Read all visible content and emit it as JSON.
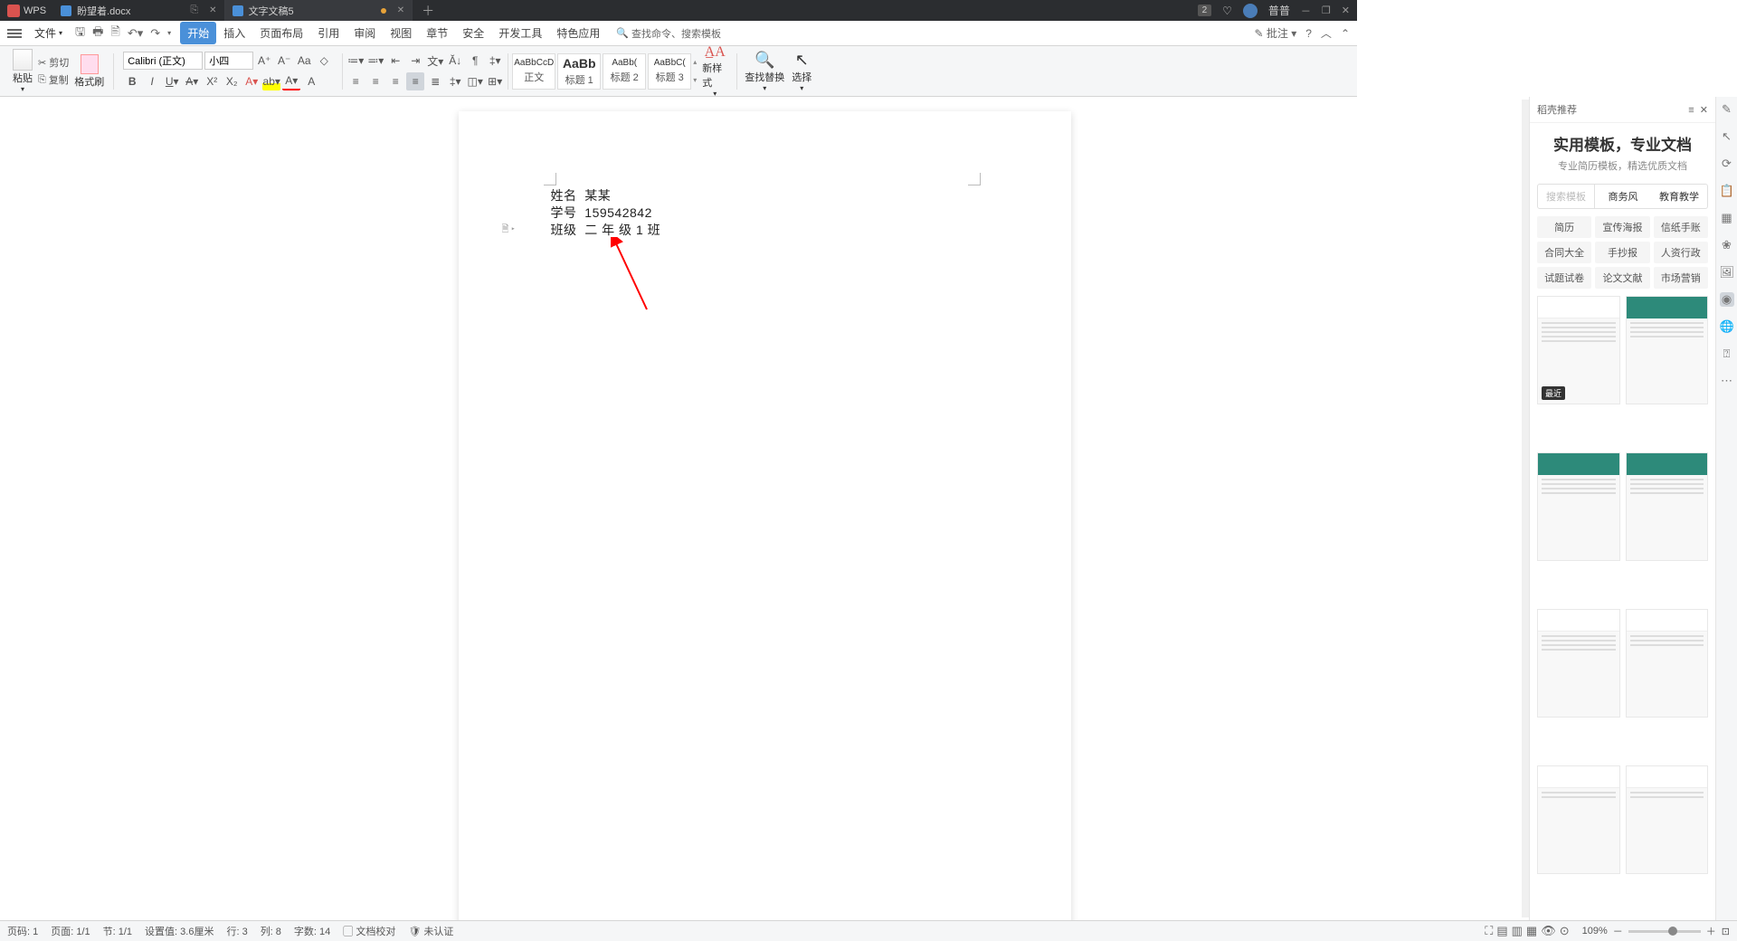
{
  "titlebar": {
    "app": "WPS",
    "tabs": [
      {
        "label": "盼望着.docx",
        "active": false,
        "modified": false
      },
      {
        "label": "文字文稿5",
        "active": true,
        "modified": true
      }
    ],
    "badge": "2",
    "user": "普普"
  },
  "menu": {
    "file": "文件",
    "tabs": [
      "开始",
      "插入",
      "页面布局",
      "引用",
      "审阅",
      "视图",
      "章节",
      "安全",
      "开发工具",
      "特色应用"
    ],
    "active_tab": "开始",
    "search_placeholder": "查找命令、搜索模板",
    "annotate": "批注"
  },
  "ribbon": {
    "paste": "粘贴",
    "cut": "剪切",
    "copy": "复制",
    "format_painter": "格式刷",
    "font_name": "Calibri (正文)",
    "font_size": "小四",
    "styles": [
      {
        "preview": "AaBbCcD",
        "label": "正文"
      },
      {
        "preview": "AaBb",
        "label": "标题 1"
      },
      {
        "preview": "AaBb(",
        "label": "标题 2"
      },
      {
        "preview": "AaBbC(",
        "label": "标题 3"
      }
    ],
    "new_style": "新样式",
    "find_replace": "查找替换",
    "select": "选择"
  },
  "document": {
    "lines": [
      {
        "key": "姓名",
        "val": "某某"
      },
      {
        "key": "学号",
        "val": "159542842"
      },
      {
        "key": "班级",
        "val": "二 年 级 1 班"
      }
    ]
  },
  "panel": {
    "header": "稻壳推荐",
    "title": "实用模板，专业文档",
    "subtitle": "专业简历模板，精选优质文档",
    "tabs": {
      "search": "搜索模板",
      "biz": "商务风",
      "edu": "教育教学"
    },
    "cats": [
      "简历",
      "宣传海报",
      "信纸手账",
      "合同大全",
      "手抄报",
      "人资行政",
      "试题试卷",
      "论文文献",
      "市场营销"
    ],
    "recent_badge": "最近"
  },
  "status": {
    "page_no": "页码: 1",
    "page": "页面: 1/1",
    "section": "节: 1/1",
    "setting": "设置值: 3.6厘米",
    "row": "行: 3",
    "col": "列: 8",
    "words": "字数: 14",
    "proof": "文档校对",
    "cert": "未认证",
    "zoom": "109%"
  }
}
